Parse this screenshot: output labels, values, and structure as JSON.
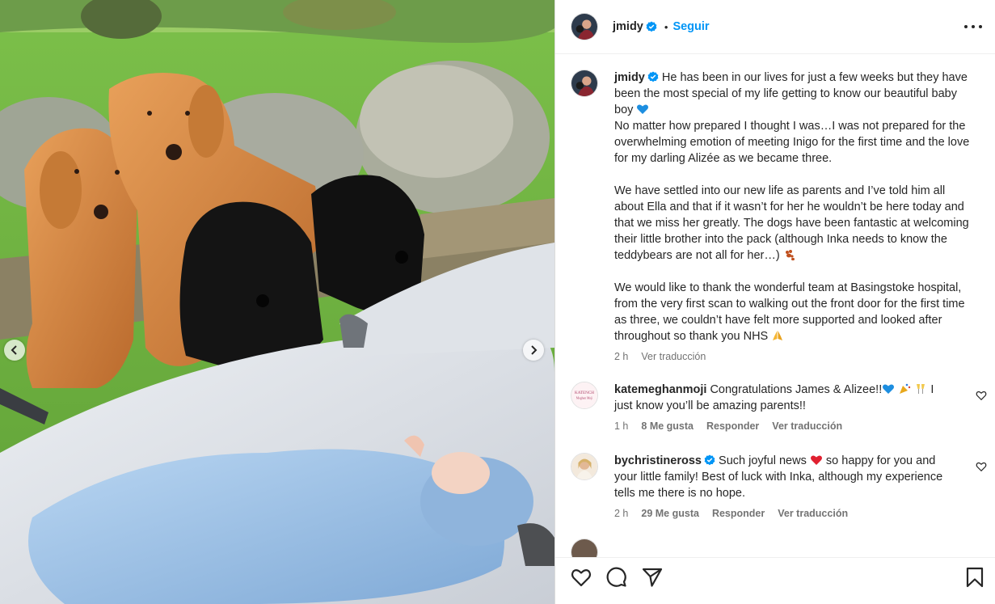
{
  "header": {
    "username": "jmidy",
    "verified": true,
    "follow_label": "Seguir",
    "separator": "•"
  },
  "caption": {
    "username": "jmidy",
    "paragraphs": [
      "He has been in our lives for just a few weeks but they have been the most special of my life getting to know our beautiful baby boy",
      "No matter how prepared I thought I was…I was not prepared for the overwhelming emotion of meeting Inigo for the first time and the love for my darling Alizée as we became three.",
      "We have settled into our new life as parents and I’ve told him all about Ella and that if it wasn’t for her he wouldn’t be here today and that we miss her greatly. The dogs have been fantastic at welcoming their little brother into the pack (although Inka needs to know the teddybears are not all for her…)",
      "We would like to thank the wonderful team at Basingstoke hospital, from the very first scan to walking out the front door for the first time as three, we couldn’t have felt more supported and looked after throughout so thank you NHS"
    ],
    "time": "2 h",
    "translate": "Ver traducción"
  },
  "comments": [
    {
      "username": "katemeghanmoji",
      "avatar_text_1": "KATENCH",
      "avatar_text_2": "Meghan Moji",
      "text_a": "Congratulations James & Alizee!!",
      "text_b": "I just know you’ll be amazing parents!!",
      "time": "1 h",
      "likes": "8 Me gusta",
      "reply": "Responder",
      "translate": "Ver traducción"
    },
    {
      "username": "bychristineross",
      "verified": true,
      "text_a": "Such joyful news",
      "text_b": "so happy for you and your little family! Best of luck with Inka, although my experience tells me there is no hope.",
      "time": "2 h",
      "likes": "29 Me gusta",
      "reply": "Responder",
      "translate": "Ver traducción"
    }
  ],
  "icons": {
    "prev": "chevron-left-icon",
    "next": "chevron-right-icon",
    "like": "heart-icon",
    "comment": "comment-icon",
    "share": "send-icon",
    "save": "bookmark-icon",
    "more": "more-options-icon"
  },
  "colors": {
    "accent": "#0095f6",
    "verified": "#0095f6",
    "muted": "#737373",
    "text": "#262626"
  }
}
